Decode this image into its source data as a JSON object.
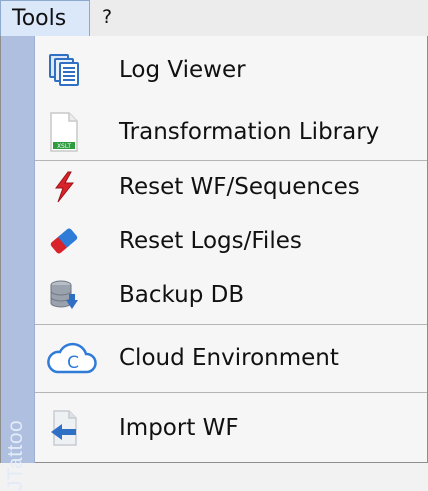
{
  "menubar": {
    "tools_label": "Tools",
    "help_label": "?"
  },
  "menu": {
    "strip_label": "JTattoo",
    "items": [
      {
        "label": "Log Viewer",
        "icon": "log-viewer-icon"
      },
      {
        "label": "Transformation Library",
        "icon": "xslt-file-icon",
        "icon_text": "XSLT"
      },
      {
        "label": "Reset WF/Sequences",
        "icon": "lightning-icon"
      },
      {
        "label": "Reset Logs/Files",
        "icon": "eraser-icon"
      },
      {
        "label": "Backup DB",
        "icon": "database-backup-icon"
      },
      {
        "label": "Cloud Environment",
        "icon": "cloud-icon",
        "icon_text": "C"
      },
      {
        "label": "Import WF",
        "icon": "import-icon"
      }
    ]
  },
  "colors": {
    "tools_tab_bg": "#dbe8fa",
    "strip_bg": "#aebfdf",
    "menu_bg": "#f6f6f6",
    "icon_blue": "#2f6fc4",
    "icon_red": "#d8232a",
    "xslt_green": "#2e9b3e"
  }
}
